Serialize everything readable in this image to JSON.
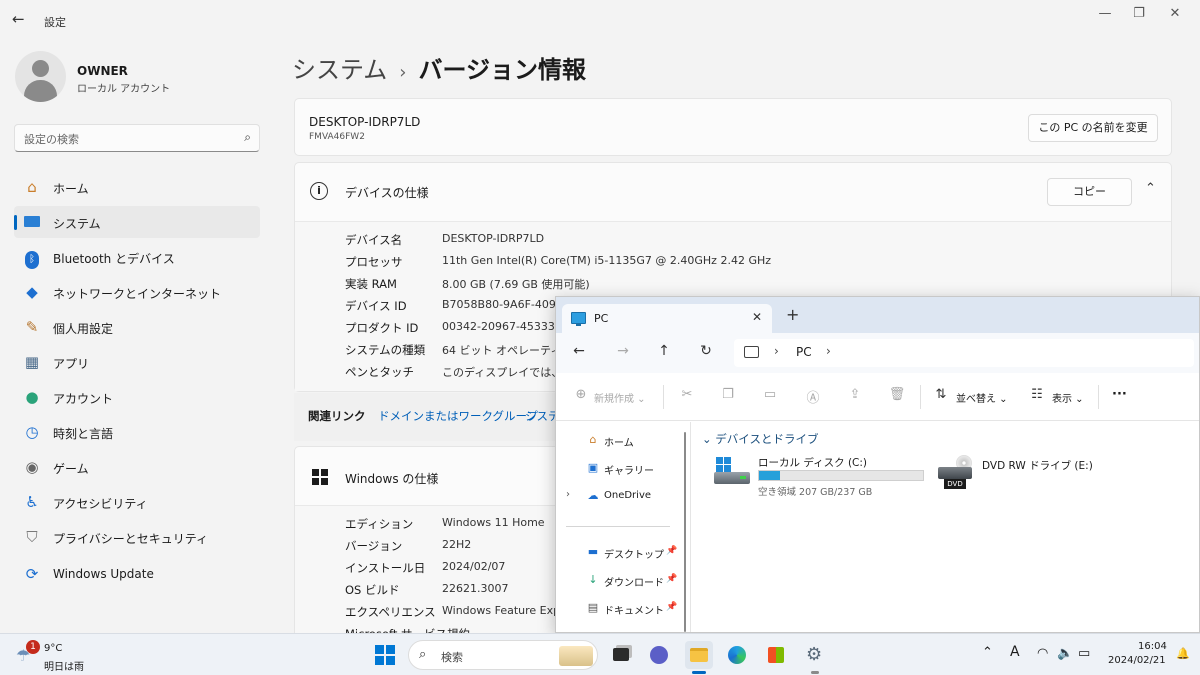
{
  "settings": {
    "title": "設定",
    "user": {
      "name": "OWNER",
      "type": "ローカル アカウント"
    },
    "search": {
      "placeholder": "設定の検索"
    },
    "nav": [
      {
        "label": "ホーム",
        "icon": "home-icon"
      },
      {
        "label": "システム",
        "icon": "system-icon",
        "active": true
      },
      {
        "label": "Bluetooth とデバイス",
        "icon": "bluetooth-icon"
      },
      {
        "label": "ネットワークとインターネット",
        "icon": "wifi-icon"
      },
      {
        "label": "個人用設定",
        "icon": "brush-icon"
      },
      {
        "label": "アプリ",
        "icon": "apps-icon"
      },
      {
        "label": "アカウント",
        "icon": "account-icon"
      },
      {
        "label": "時刻と言語",
        "icon": "time-language-icon"
      },
      {
        "label": "ゲーム",
        "icon": "gamepad-icon"
      },
      {
        "label": "アクセシビリティ",
        "icon": "accessibility-icon"
      },
      {
        "label": "プライバシーとセキュリティ",
        "icon": "shield-icon"
      },
      {
        "label": "Windows Update",
        "icon": "update-icon"
      }
    ],
    "breadcrumb": {
      "parent": "システム",
      "separator": "›",
      "current": "バージョン情報"
    },
    "device": {
      "name": "DESKTOP-IDRP7LD",
      "model": "FMVA46FW2",
      "rename_button": "この PC の名前を変更"
    },
    "device_specs": {
      "title": "デバイスの仕様",
      "copy_button": "コピー",
      "rows": [
        {
          "label": "デバイス名",
          "value": "DESKTOP-IDRP7LD"
        },
        {
          "label": "プロセッサ",
          "value": "11th Gen Intel(R) Core(TM) i5-1135G7 @ 2.40GHz   2.42 GHz"
        },
        {
          "label": "実装 RAM",
          "value": "8.00 GB (7.69 GB 使用可能)"
        },
        {
          "label": "デバイス ID",
          "value": "B7058B80-9A6F-4090"
        },
        {
          "label": "プロダクト ID",
          "value": "00342-20967-45333-"
        },
        {
          "label": "システムの種類",
          "value": "64 ビット オペレーティング"
        },
        {
          "label": "ペンとタッチ",
          "value": "このディスプレイでは、ペン"
        }
      ]
    },
    "related": {
      "label": "関連リンク",
      "links": [
        "ドメインまたはワークグループ",
        "システ"
      ]
    },
    "windows_specs": {
      "title": "Windows の仕様",
      "rows": [
        {
          "label": "エディション",
          "value": "Windows 11 Home"
        },
        {
          "label": "バージョン",
          "value": "22H2"
        },
        {
          "label": "インストール日",
          "value": "2024/02/07"
        },
        {
          "label": "OS ビルド",
          "value": "22621.3007"
        },
        {
          "label": "エクスペリエンス",
          "value": "Windows Feature Exp"
        },
        {
          "label": "Microsoft サービス規約",
          "value": ""
        }
      ]
    }
  },
  "explorer": {
    "tab_title": "PC",
    "new_tab": "+",
    "address": "PC",
    "commands": {
      "new": "新規作成",
      "sort": "並べ替え",
      "view": "表示",
      "more": "···"
    },
    "sidebar": [
      {
        "label": "ホーム",
        "icon": "home-icon"
      },
      {
        "label": "ギャラリー",
        "icon": "gallery-icon"
      },
      {
        "label": "OneDrive",
        "icon": "onedrive-icon"
      },
      {
        "label": "デスクトップ",
        "icon": "desktop-icon",
        "pinned": true
      },
      {
        "label": "ダウンロード",
        "icon": "download-icon",
        "pinned": true
      },
      {
        "label": "ドキュメント",
        "icon": "document-icon",
        "pinned": true
      }
    ],
    "group_title": "デバイスとドライブ",
    "drives": [
      {
        "name": "ローカル ディスク (C:)",
        "space": "空き領域 207 GB/237 GB",
        "used_fraction": 0.127
      },
      {
        "name": "DVD RW ドライブ (E:)",
        "badge": "DVD"
      }
    ]
  },
  "taskbar": {
    "weather": {
      "temp": "9°C",
      "desc": "明日は雨",
      "badge": "1"
    },
    "search_placeholder": "検索",
    "tray": {
      "ime": "A"
    },
    "clock": {
      "time": "16:04",
      "date": "2024/02/21"
    }
  }
}
